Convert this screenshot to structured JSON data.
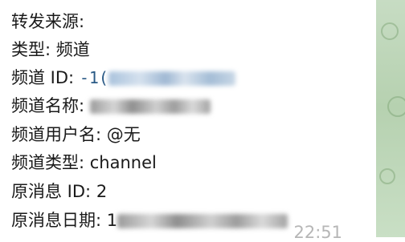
{
  "message": {
    "lines": [
      {
        "label": "转发来源:",
        "value": ""
      },
      {
        "label": "类型:",
        "value": "频道"
      },
      {
        "label": "频道 ID:",
        "value": "-1("
      },
      {
        "label": "频道名称:",
        "value": ""
      },
      {
        "label": "频道用户名:",
        "value": "@无"
      },
      {
        "label": "频道类型:",
        "value": "channel"
      },
      {
        "label": "原消息 ID:",
        "value": "2"
      },
      {
        "label": "原消息日期:",
        "value": "1"
      }
    ],
    "time": "22:51"
  },
  "colors": {
    "background_right": "#c7dcc3",
    "id_value": "#2a5a86",
    "time": "#b6b6b6"
  }
}
